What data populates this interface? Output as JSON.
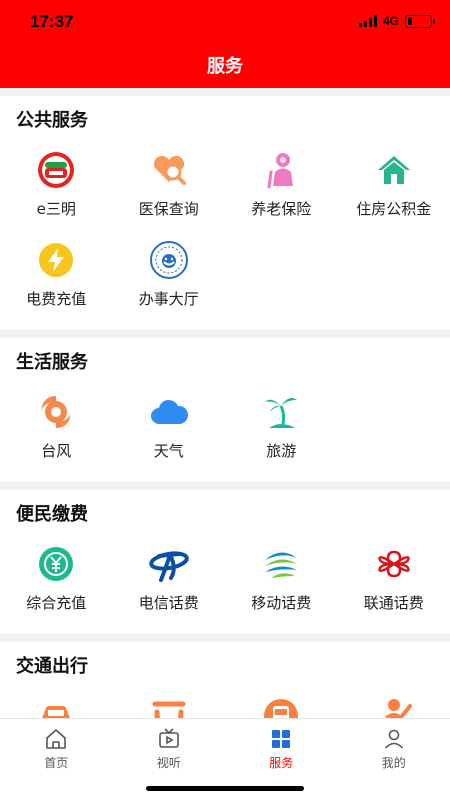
{
  "status": {
    "time": "17:37",
    "network": "4G",
    "battery_level": 0.2
  },
  "header": {
    "title": "服务"
  },
  "sections": [
    {
      "title": "公共服务",
      "items": [
        {
          "label": "e三明",
          "icon": "e-sanming-logo-icon"
        },
        {
          "label": "医保查询",
          "icon": "heart-search-icon"
        },
        {
          "label": "养老保险",
          "icon": "elderly-person-icon"
        },
        {
          "label": "住房公积金",
          "icon": "house-icon"
        },
        {
          "label": "电费充值",
          "icon": "lightning-icon"
        },
        {
          "label": "办事大厅",
          "icon": "service-hall-seal-icon"
        }
      ]
    },
    {
      "title": "生活服务",
      "items": [
        {
          "label": "台风",
          "icon": "typhoon-icon"
        },
        {
          "label": "天气",
          "icon": "cloud-icon"
        },
        {
          "label": "旅游",
          "icon": "palm-tree-icon"
        }
      ]
    },
    {
      "title": "便民缴费",
      "items": [
        {
          "label": "综合充值",
          "icon": "yuan-recharge-icon"
        },
        {
          "label": "电信话费",
          "icon": "china-telecom-icon"
        },
        {
          "label": "移动话费",
          "icon": "china-mobile-icon"
        },
        {
          "label": "联通话费",
          "icon": "china-unicom-icon"
        }
      ]
    },
    {
      "title": "交通出行",
      "items": [
        {
          "label": "",
          "icon": "car-icon"
        },
        {
          "label": "",
          "icon": "didi-icon"
        },
        {
          "label": "",
          "icon": "bus-icon"
        },
        {
          "label": "",
          "icon": "person-waving-icon"
        }
      ]
    }
  ],
  "tabbar": [
    {
      "label": "首页",
      "icon": "home-icon",
      "active": false
    },
    {
      "label": "视听",
      "icon": "tv-icon",
      "active": false
    },
    {
      "label": "服务",
      "icon": "grid-icon",
      "active": true
    },
    {
      "label": "我的",
      "icon": "user-icon",
      "active": false
    }
  ],
  "colors": {
    "brand": "#fe0000",
    "active_tab": "#fe0000"
  }
}
